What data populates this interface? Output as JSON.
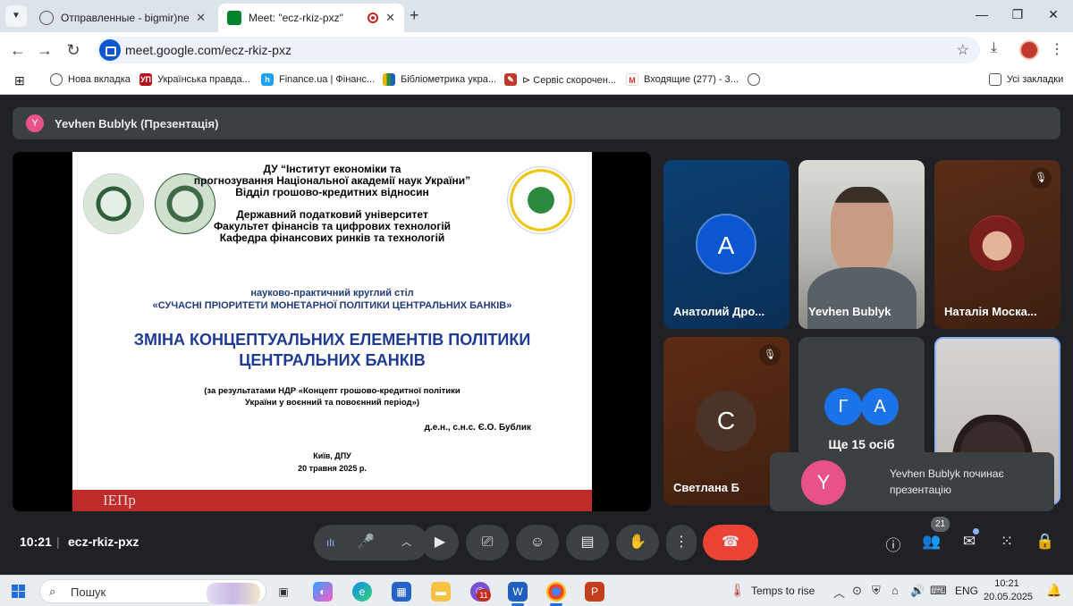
{
  "browser": {
    "tabs": [
      {
        "title": "Отправленные - bigmir)net",
        "active": false
      },
      {
        "title": "Meet: \"ecz-rkiz-pxz\"",
        "active": true
      }
    ],
    "url": "meet.google.com/ecz-rkiz-pxz",
    "bookmarks": [
      "Нова вкладка",
      "Українська правда...",
      "Finance.ua | Фінанс...",
      "Бібліометрика укра...",
      "⊳ Сервіс скорочен...",
      "Входящие (277) - 3...",
      "Усі закладки"
    ]
  },
  "meet": {
    "presenter_initial": "Y",
    "presenter_label": "Yevhen Bublyk (Презентація)",
    "slide": {
      "institution": [
        "ДУ “Інститут економіки та",
        "прогнозування Національної академії наук України”",
        "Відділ грошово-кредитних відносин",
        "Державний податковий університет",
        "Факультет фінансів та цифрових технологій",
        "Кафедра фінансових ринків та технологій"
      ],
      "roundtable": "науково-практичний круглий стіл",
      "roundtable_name": "«СУЧАСНІ ПРІОРИТЕТИ МОНЕТАРНОЇ ПОЛІТИКИ ЦЕНТРАЛЬНИХ БАНКІВ»",
      "title_line1": "ЗМІНА КОНЦЕПТУАЛЬНИХ ЕЛЕМЕНТІВ ПОЛІТИКИ",
      "title_line2": "ЦЕНТРАЛЬНИХ БАНКІВ",
      "note_line1": "(за результатами НДР «Концепт грошово-кредитної політики",
      "note_line2": "України у воєнний та повоєнний період»)",
      "author": "д.е.н., с.н.с. Є.О. Бублик",
      "city": "Київ, ДПУ",
      "date": "20 травня 2025 р.",
      "footer_logo": "ІЕПр"
    },
    "participants": [
      {
        "name": "Анатолий Дро...",
        "initial": "А",
        "muted": false
      },
      {
        "name": "Yevhen Bublyk",
        "initial": "",
        "muted": false
      },
      {
        "name": "Наталія Моска...",
        "initial": "",
        "muted": true
      },
      {
        "name": "Светлана Б",
        "initial": "С",
        "muted": true
      },
      {
        "name": "Ще 15 осіб",
        "initials": [
          "Г",
          "А"
        ],
        "muted": false
      }
    ],
    "toast": {
      "initial": "Y",
      "text": "Yevhen Bublyk починає презентацію"
    },
    "controls": {
      "time": "10:21",
      "separator": "|",
      "code": "ecz-rkiz-pxz",
      "people_count": "21"
    }
  },
  "taskbar": {
    "search_placeholder": "Пошук",
    "weather": "Temps to rise",
    "lang": "ENG",
    "time": "10:21",
    "date": "20.05.2025",
    "notification_count": "11"
  },
  "colors": {
    "meet_bg": "#202124",
    "panel": "#3c4043",
    "end_call": "#ea4335",
    "accent_blue": "#0b57d0",
    "slide_title": "#1f3a93",
    "slide_footer": "#bf2b2b",
    "presenter_avatar": "#e8528a"
  },
  "icons": [
    "globe-icon",
    "meet-icon",
    "record-icon",
    "back-icon",
    "forward-icon",
    "reload-icon",
    "star-icon",
    "download-icon",
    "apps-icon",
    "mic-icon",
    "camera-icon",
    "present-icon",
    "emoji-icon",
    "captions-icon",
    "raise-hand-icon",
    "more-icon",
    "end-call-icon",
    "info-icon",
    "people-icon",
    "chat-icon",
    "activities-icon",
    "host-controls-icon",
    "mic-off-icon"
  ]
}
